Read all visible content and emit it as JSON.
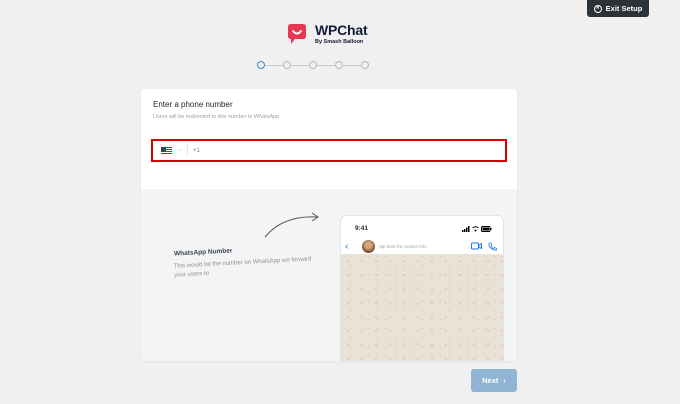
{
  "header": {
    "exit_label": "Exit Setup",
    "logo_title": "WPChat",
    "logo_subtitle": "By Smash Balloon"
  },
  "stepper": {
    "total_steps": 5,
    "current_step": 1
  },
  "form": {
    "title": "Enter a phone number",
    "subtitle": "Users will be redirected to this number in WhatsApp",
    "country_flag": "us-flag-icon",
    "dial_code": "+1",
    "phone_value": ""
  },
  "preview": {
    "label_title": "WhatsApp Number",
    "label_desc": "This would be the number on WhatsApp we forward your users to",
    "phone_time": "9:41",
    "contact_hint": "tap here for contact info"
  },
  "footer": {
    "next_label": "Next"
  },
  "colors": {
    "accent": "#3a8ac7",
    "brand": "#e8384f",
    "field_highlight": "#d60000",
    "next_button": "#8fb4d4"
  }
}
